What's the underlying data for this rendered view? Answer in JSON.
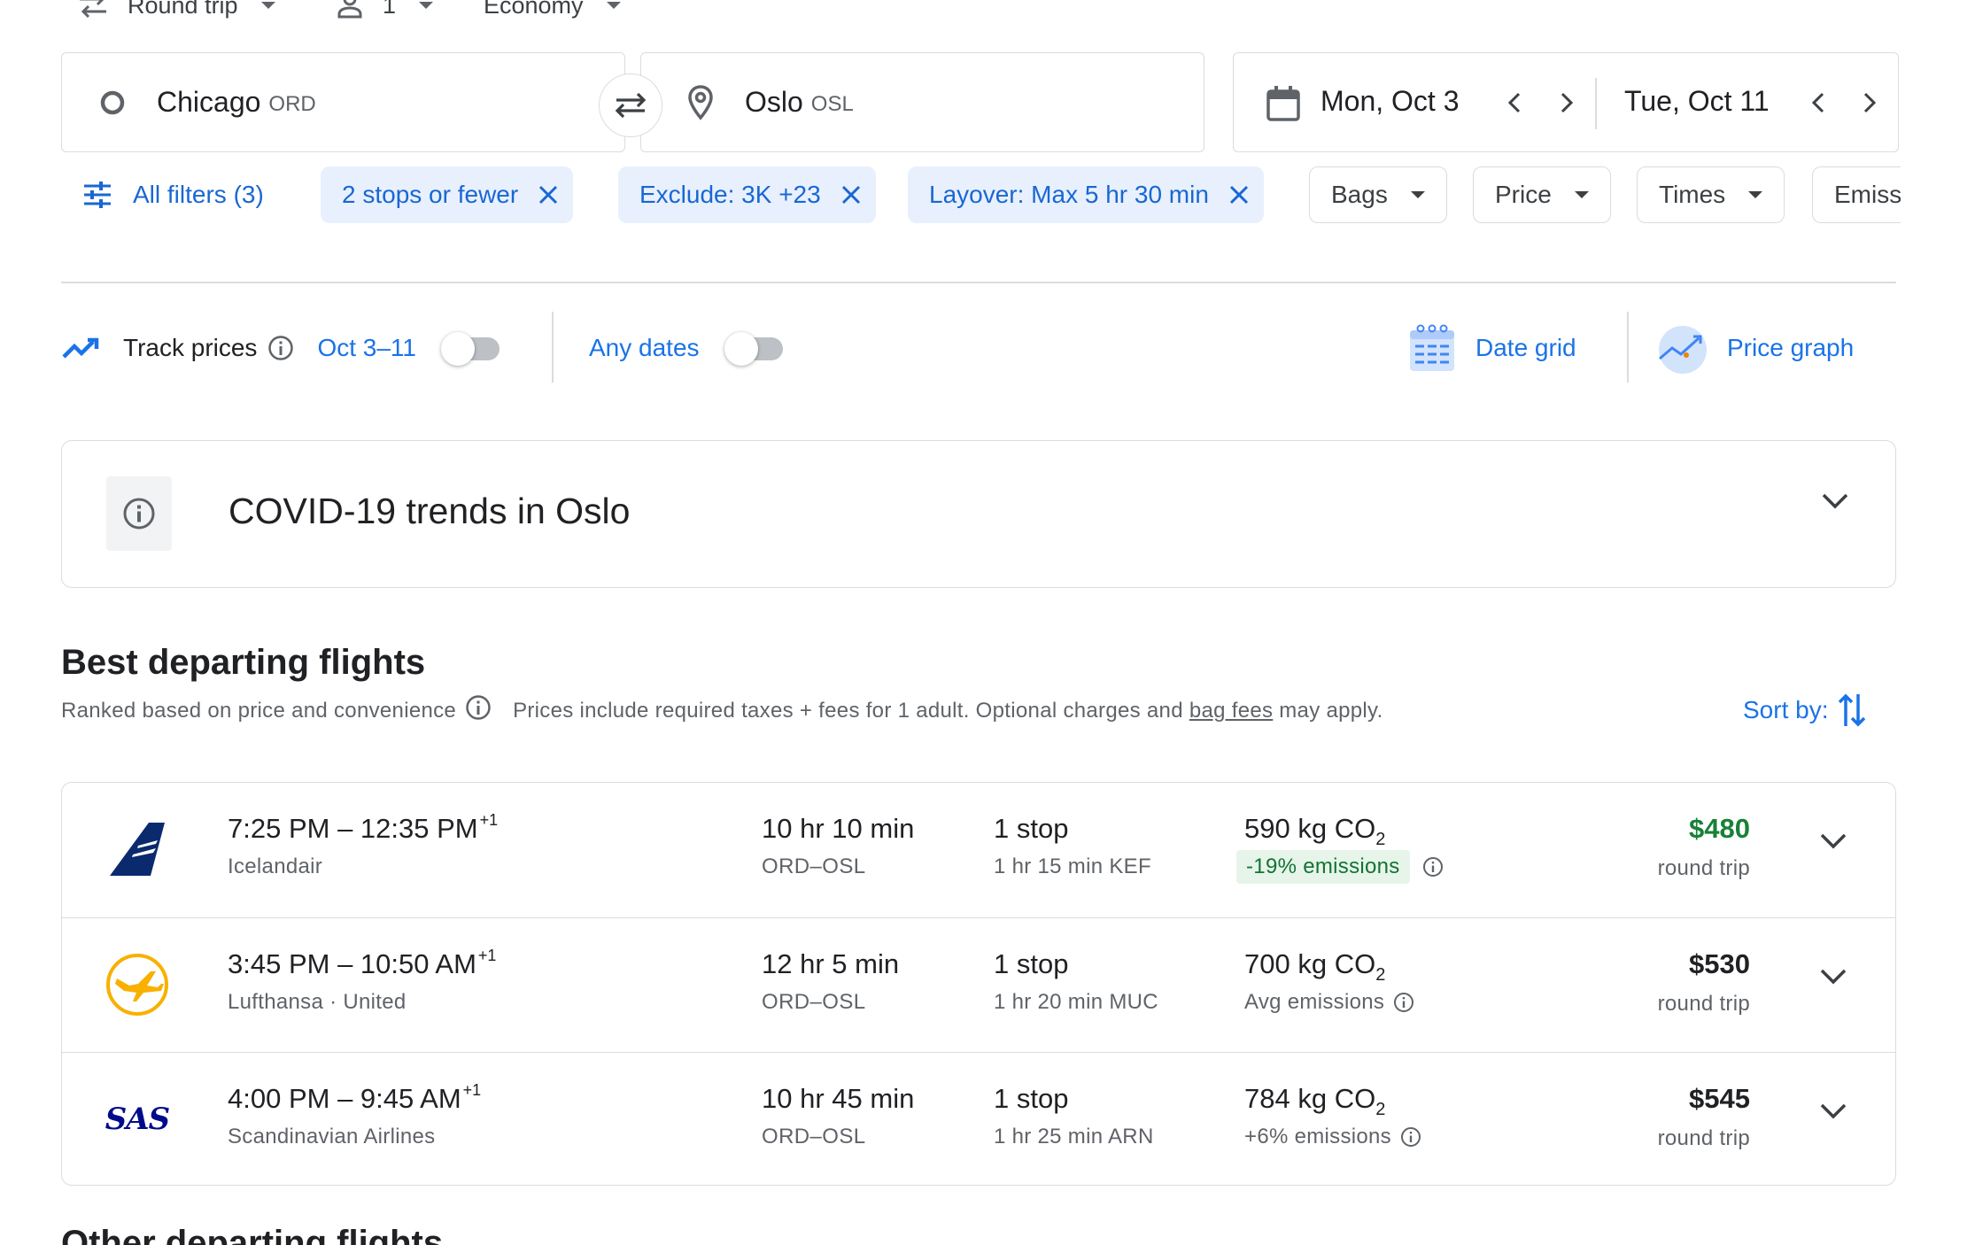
{
  "top": {
    "trip_type": "Round trip",
    "passengers": "1",
    "cabin": "Economy"
  },
  "search": {
    "origin_city": "Chicago",
    "origin_code": "ORD",
    "destination_city": "Oslo",
    "destination_code": "OSL",
    "depart_date": "Mon, Oct 3",
    "return_date": "Tue, Oct 11"
  },
  "filters": {
    "all_filters": "All filters (3)",
    "active": [
      "2 stops or fewer",
      "Exclude: 3K +23",
      "Layover: Max 5 hr 30 min"
    ],
    "dropdowns": [
      "Bags",
      "Price",
      "Times",
      "Emiss"
    ]
  },
  "track": {
    "label": "Track prices",
    "range": "Oct 3–11",
    "any_dates": "Any dates",
    "date_grid": "Date grid",
    "price_graph": "Price graph",
    "track_on": false,
    "any_dates_on": false
  },
  "covid": {
    "title": "COVID-19 trends in Oslo"
  },
  "best": {
    "title": "Best departing flights",
    "ranked": "Ranked based on price and convenience",
    "prices_note_1": "Prices include required taxes + fees for 1 adult. Optional charges and ",
    "bag_fees": "bag fees",
    "prices_note_2": " may apply.",
    "sort_by": "Sort by:"
  },
  "flights": [
    {
      "depart": "7:25 PM",
      "arrive": "12:35 PM",
      "day_offset": "+1",
      "airline": "Icelandair",
      "duration": "10 hr 10 min",
      "route": "ORD–OSL",
      "stops": "1 stop",
      "layover": "1 hr 15 min KEF",
      "co2_value": "590 kg CO",
      "co2_sub": "2",
      "emissions": "-19% emissions",
      "price": "$480",
      "price_type": "round trip",
      "logo": "icelandair-logo"
    },
    {
      "depart": "3:45 PM",
      "arrive": "10:50 AM",
      "day_offset": "+1",
      "airline": "Lufthansa · United",
      "duration": "12 hr 5 min",
      "route": "ORD–OSL",
      "stops": "1 stop",
      "layover": "1 hr 20 min MUC",
      "co2_value": "700 kg CO",
      "co2_sub": "2",
      "emissions": "Avg emissions",
      "price": "$530",
      "price_type": "round trip",
      "logo": "lufthansa-logo"
    },
    {
      "depart": "4:00 PM",
      "arrive": "9:45 AM",
      "day_offset": "+1",
      "airline": "Scandinavian Airlines",
      "duration": "10 hr 45 min",
      "route": "ORD–OSL",
      "stops": "1 stop",
      "layover": "1 hr 25 min ARN",
      "co2_value": "784 kg CO",
      "co2_sub": "2",
      "emissions": "+6% emissions",
      "price": "$545",
      "price_type": "round trip",
      "logo": "sas-logo",
      "logo_text": "SAS"
    }
  ],
  "other": {
    "title": "Other departing flights"
  },
  "colors": {
    "accent": "#1a73e8",
    "chip_bg": "#e8f0fe",
    "good_price": "#188038",
    "emissions_badge": "#e6f4ea",
    "border": "#dadce0",
    "icelandair": "#0b2a6e",
    "lufthansa": "#f9b000",
    "sas": "#000b8c"
  }
}
